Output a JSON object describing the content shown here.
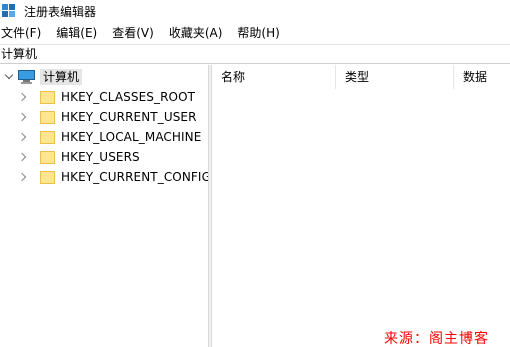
{
  "window": {
    "title": "注册表编辑器",
    "icon": "registry-editor-icon"
  },
  "menu": {
    "items": [
      "文件(F)",
      "编辑(E)",
      "查看(V)",
      "收藏夹(A)",
      "帮助(H)"
    ]
  },
  "address": {
    "path": "计算机"
  },
  "tree": {
    "root_label": "计算机",
    "root_icon": "computer-icon",
    "hives": [
      "HKEY_CLASSES_ROOT",
      "HKEY_CURRENT_USER",
      "HKEY_LOCAL_MACHINE",
      "HKEY_USERS",
      "HKEY_CURRENT_CONFIG"
    ]
  },
  "list": {
    "columns": [
      "名称",
      "类型",
      "数据"
    ]
  },
  "watermark": {
    "text": "来源：阁主博客",
    "color": "#ff0000"
  }
}
